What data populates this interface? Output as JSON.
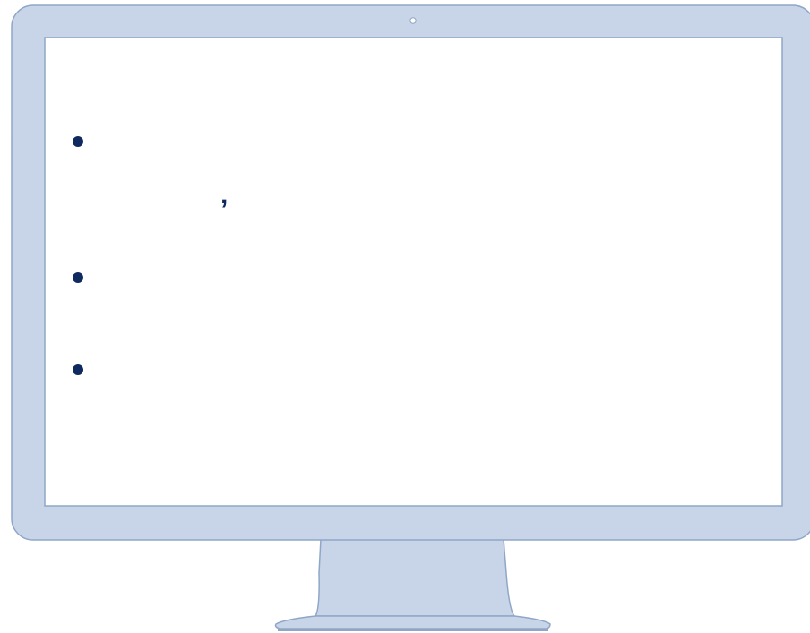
{
  "colors": {
    "frame": "#c8d5e8",
    "frame_border": "#8fa6c7",
    "screen": "#ffffff",
    "bullet": "#0f2a5e"
  },
  "screen": {
    "bullets": [
      {
        "text": ""
      },
      {
        "text": ""
      },
      {
        "text": ""
      }
    ],
    "stray_punctuation": ","
  }
}
